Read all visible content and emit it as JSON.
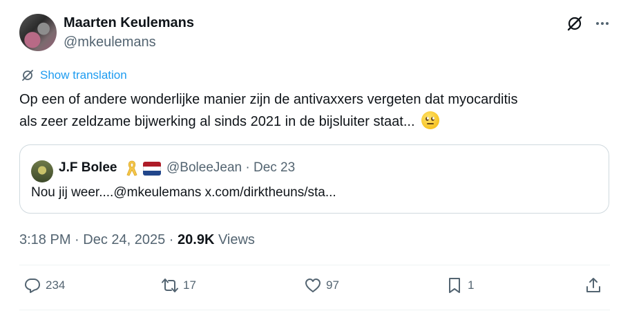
{
  "author": {
    "name": "Maarten Keulemans",
    "handle": "@mkeulemans"
  },
  "translate": {
    "label": "Show translation"
  },
  "tweet": {
    "text_line1": "Op een of andere wonderlijke manier zijn de antivaxxers vergeten dat myocarditis",
    "text_line2": "als zeer zeldzame bijwerking al sinds 2021 in de bijsluiter staat..."
  },
  "quote": {
    "name": "J.F Bolee",
    "meta": "@BoleeJean · Dec 23",
    "text": "Nou jij weer....@mkeulemans x.com/dirktheuns/sta..."
  },
  "meta": {
    "time": "3:18 PM · Dec 24, 2025 · ",
    "views_count": "20.9K",
    "views_label": " Views"
  },
  "actions": {
    "replies": "234",
    "reposts": "17",
    "likes": "97",
    "bookmarks": "1"
  },
  "icons": [
    "grok-icon",
    "more-icon",
    "translate-icon",
    "ribbon-icon",
    "netherlands-flag-icon",
    "reply-icon",
    "repost-icon",
    "like-icon",
    "bookmark-icon",
    "share-icon"
  ],
  "colors": {
    "accent": "#1d9bf0",
    "secondary_text": "#536471",
    "flag_red": "#ae1c28",
    "flag_white": "#ffffff",
    "flag_blue": "#21468b"
  }
}
